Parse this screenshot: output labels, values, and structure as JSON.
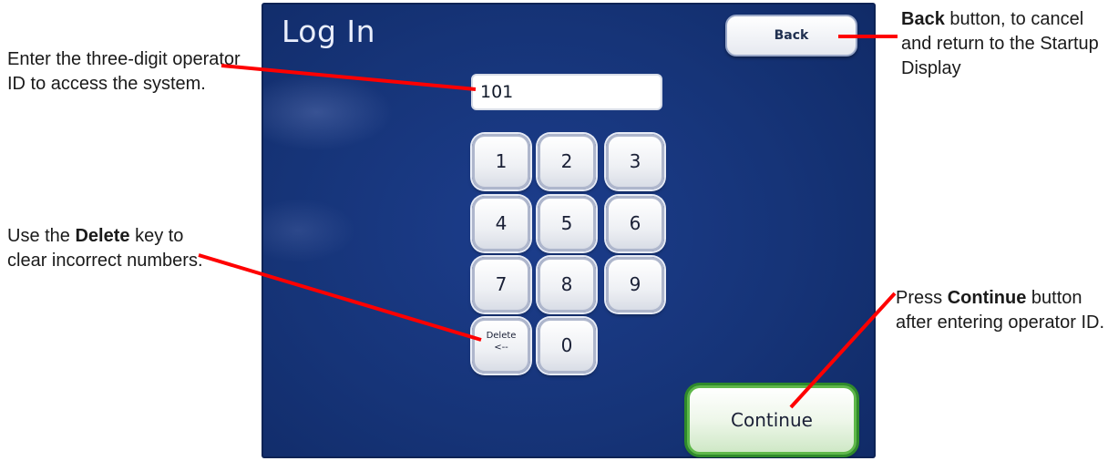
{
  "screen": {
    "title": "Log In",
    "back_label": "Back",
    "operator_id_value": "101",
    "keypad": [
      "1",
      "2",
      "3",
      "4",
      "5",
      "6",
      "7",
      "8",
      "9"
    ],
    "delete_line1": "Delete",
    "delete_line2": "<--",
    "zero_label": "0",
    "continue_label": "Continue"
  },
  "callouts": {
    "enter_id": "Enter the three-digit operator ID to access the system.",
    "delete_pre": "Use the ",
    "delete_bold": "Delete",
    "delete_post": " key to clear incorrect numbers.",
    "back_bold": "Back",
    "back_post": " button, to cancel and return to the Startup Display",
    "continue_pre": "Press ",
    "continue_bold": "Continue",
    "continue_post": " button after entering operator ID."
  },
  "colors": {
    "screen_bg": "#163478",
    "callout_line": "#ff0000",
    "continue_border": "#2f8a2a"
  }
}
